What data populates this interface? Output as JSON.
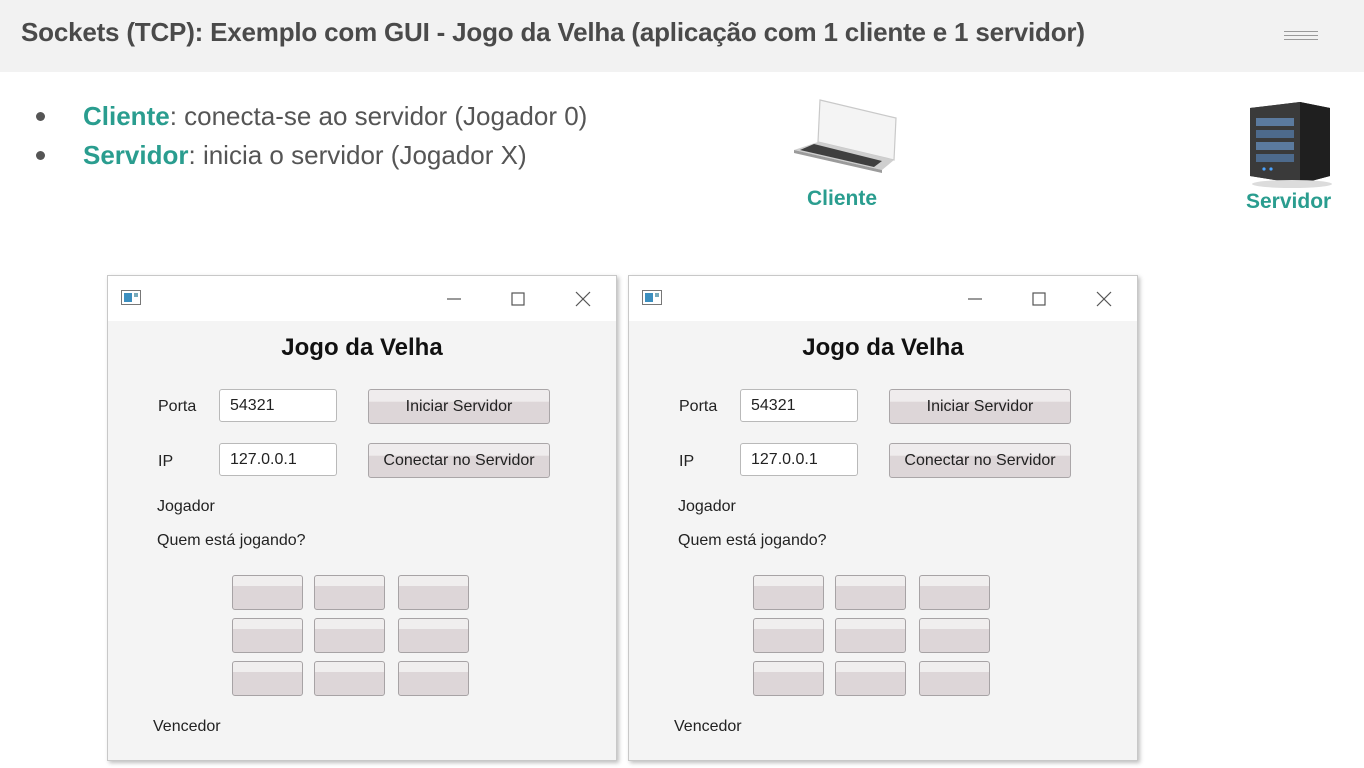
{
  "slide": {
    "title": "Sockets (TCP): Exemplo com GUI - Jogo da Velha (aplicação com 1 cliente e 1 servidor)",
    "bullets": [
      {
        "term": "Cliente",
        "text": ": conecta-se ao servidor (Jogador 0)"
      },
      {
        "term": "Servidor",
        "text": ": inicia o servidor (Jogador X)"
      }
    ],
    "devices": {
      "client_label": "Cliente",
      "server_label": "Servidor"
    }
  },
  "windows": [
    {
      "heading": "Jogo da Velha",
      "port_label": "Porta",
      "port_value": "54321",
      "ip_label": "IP",
      "ip_value": "127.0.0.1",
      "start_button": "Iniciar Servidor",
      "connect_button": "Conectar no Servidor",
      "player_label": "Jogador",
      "turn_label": "Quem está jogando?",
      "board": [
        "",
        "",
        "",
        "",
        "",
        "",
        "",
        "",
        ""
      ],
      "winner_label": "Vencedor"
    },
    {
      "heading": "Jogo da Velha",
      "port_label": "Porta",
      "port_value": "54321",
      "ip_label": "IP",
      "ip_value": "127.0.0.1",
      "start_button": "Iniciar Servidor",
      "connect_button": "Conectar no Servidor",
      "player_label": "Jogador",
      "turn_label": "Quem está jogando?",
      "board": [
        "",
        "",
        "",
        "",
        "",
        "",
        "",
        "",
        ""
      ],
      "winner_label": "Vencedor"
    }
  ],
  "colors": {
    "accent": "#2a9d8f",
    "title": "#4a4a4a",
    "button_fill": "#ddd6d8"
  },
  "icons": [
    "menu-icon",
    "laptop-icon",
    "server-icon",
    "app-icon",
    "minimize-icon",
    "maximize-icon",
    "close-icon"
  ]
}
